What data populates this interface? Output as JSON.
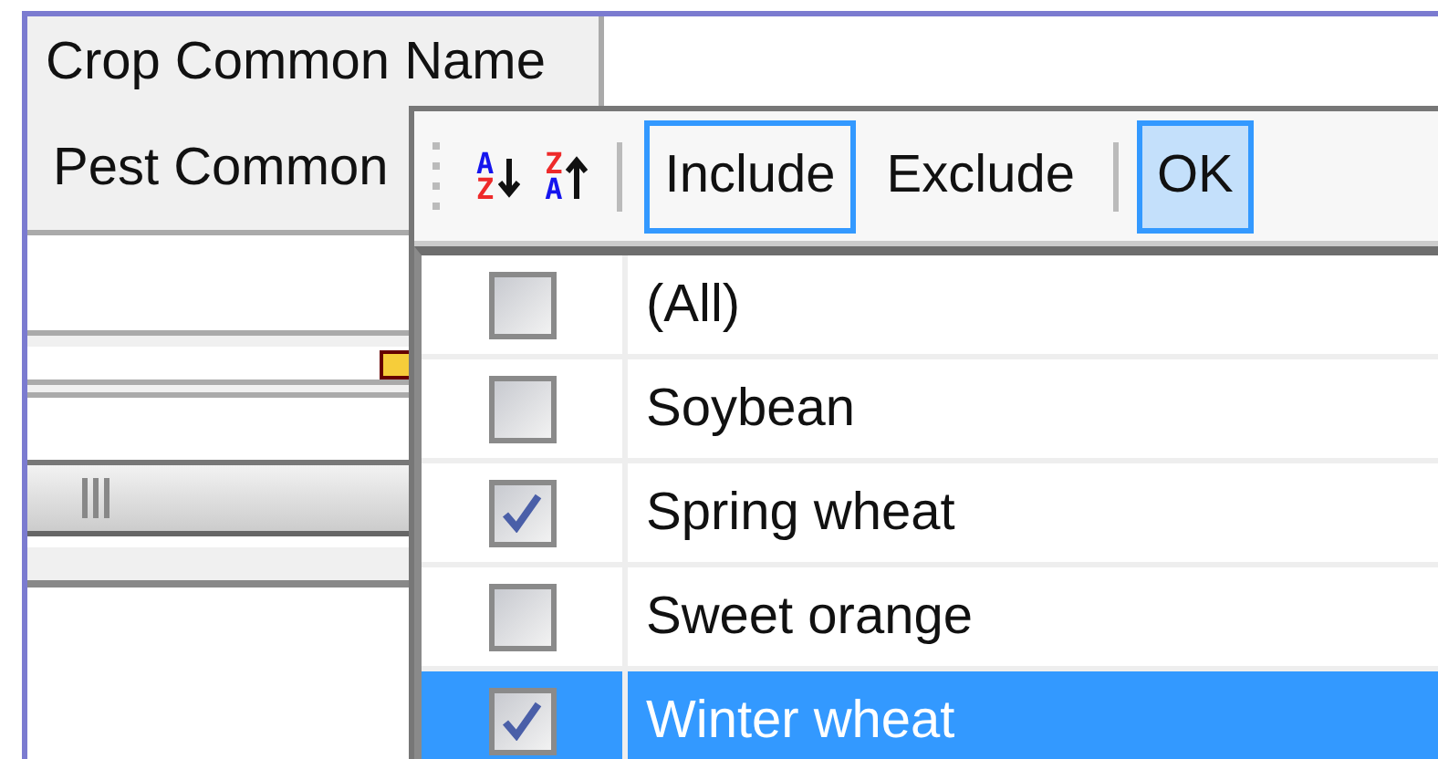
{
  "grid": {
    "header": "Crop Common Name",
    "row_label": "Pest Common"
  },
  "filter_popup": {
    "sort_buttons": [
      {
        "kind": "ascending",
        "upper": "A",
        "lower": "Z"
      },
      {
        "kind": "descending",
        "upper": "Z",
        "lower": "A"
      }
    ],
    "buttons": [
      {
        "label": "Include",
        "focused": true,
        "pressed": false
      },
      {
        "label": "Exclude",
        "focused": false,
        "pressed": false
      },
      {
        "label": "OK",
        "focused": false,
        "pressed": true
      }
    ],
    "items": [
      {
        "label": "(All)",
        "checked": false,
        "selected": false
      },
      {
        "label": "Soybean",
        "checked": false,
        "selected": false
      },
      {
        "label": "Spring wheat",
        "checked": true,
        "selected": false
      },
      {
        "label": "Sweet orange",
        "checked": false,
        "selected": false
      },
      {
        "label": "Winter wheat",
        "checked": true,
        "selected": true
      }
    ]
  }
}
